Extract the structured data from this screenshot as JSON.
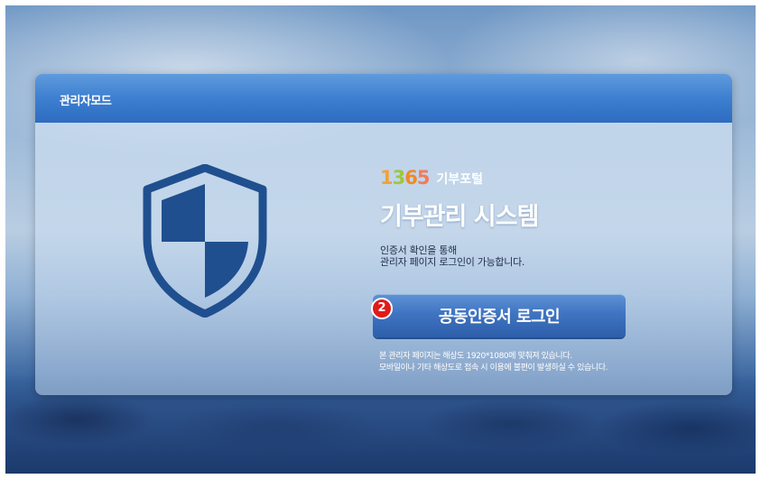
{
  "panel": {
    "title": "관리자모드"
  },
  "brand": {
    "number_digits": [
      "1",
      "3",
      "6",
      "5"
    ],
    "name": "기부포털"
  },
  "system_title": "기부관리 시스템",
  "description": {
    "line1": "인증서 확인을 통해",
    "line2": "관리자 페이지 로그인이 가능합니다."
  },
  "login_button": {
    "label": "공동인증서 로그인"
  },
  "step_badge": "2",
  "notice": {
    "line1": "본 관리자 페이지는 해상도 1920*1080에 맞춰져 있습니다.",
    "line2": "모바일이나 기타 해상도로 접속 시 이용에 불편이 발생하실 수 있습니다."
  },
  "colors": {
    "header_blue": "#3d7fd0",
    "shield_blue": "#1f4f8f",
    "button_blue": "#3f74c2",
    "badge_red": "#e01b1b"
  },
  "icons": {
    "shield": "shield-icon"
  }
}
